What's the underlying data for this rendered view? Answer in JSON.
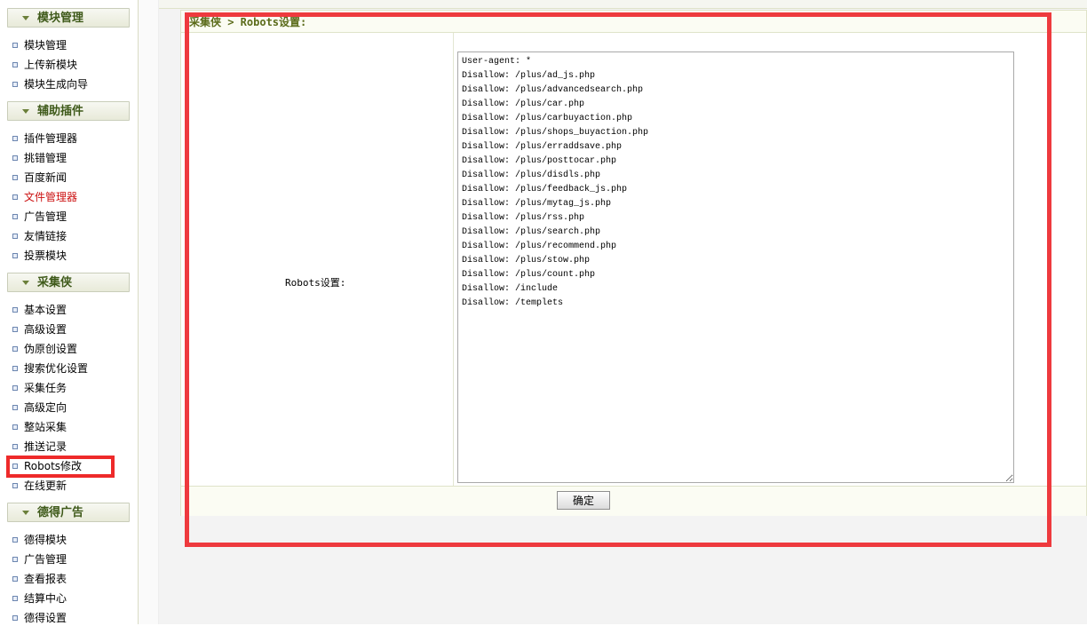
{
  "sidebar": {
    "sections": [
      {
        "title": "模块管理",
        "items": [
          "模块管理",
          "上传新模块",
          "模块生成向导"
        ]
      },
      {
        "title": "辅助插件",
        "items": [
          "插件管理器",
          "挑错管理",
          "百度新闻",
          "文件管理器",
          "广告管理",
          "友情链接",
          "投票模块"
        ]
      },
      {
        "title": "采集侠",
        "items": [
          "基本设置",
          "高级设置",
          "伪原创设置",
          "搜索优化设置",
          "采集任务",
          "高级定向",
          "整站采集",
          "推送记录",
          "Robots修改",
          "在线更新"
        ]
      },
      {
        "title": "德得广告",
        "items": [
          "德得模块",
          "广告管理",
          "查看报表",
          "结算中心",
          "德得设置"
        ]
      }
    ]
  },
  "main": {
    "breadcrumb": "采集侠 > Robots设置:",
    "field_label": "Robots设置:",
    "robots_text": "User-agent: *\nDisallow: /plus/ad_js.php\nDisallow: /plus/advancedsearch.php\nDisallow: /plus/car.php\nDisallow: /plus/carbuyaction.php\nDisallow: /plus/shops_buyaction.php\nDisallow: /plus/erraddsave.php\nDisallow: /plus/posttocar.php\nDisallow: /plus/disdls.php\nDisallow: /plus/feedback_js.php\nDisallow: /plus/mytag_js.php\nDisallow: /plus/rss.php\nDisallow: /plus/search.php\nDisallow: /plus/recommend.php\nDisallow: /plus/stow.php\nDisallow: /plus/count.php\nDisallow: /include\nDisallow: /templets",
    "submit_label": "确定"
  },
  "colors": {
    "highlight": "#ee3a3e",
    "active_item": "#cc1111",
    "section_title": "#3f5a1a"
  }
}
